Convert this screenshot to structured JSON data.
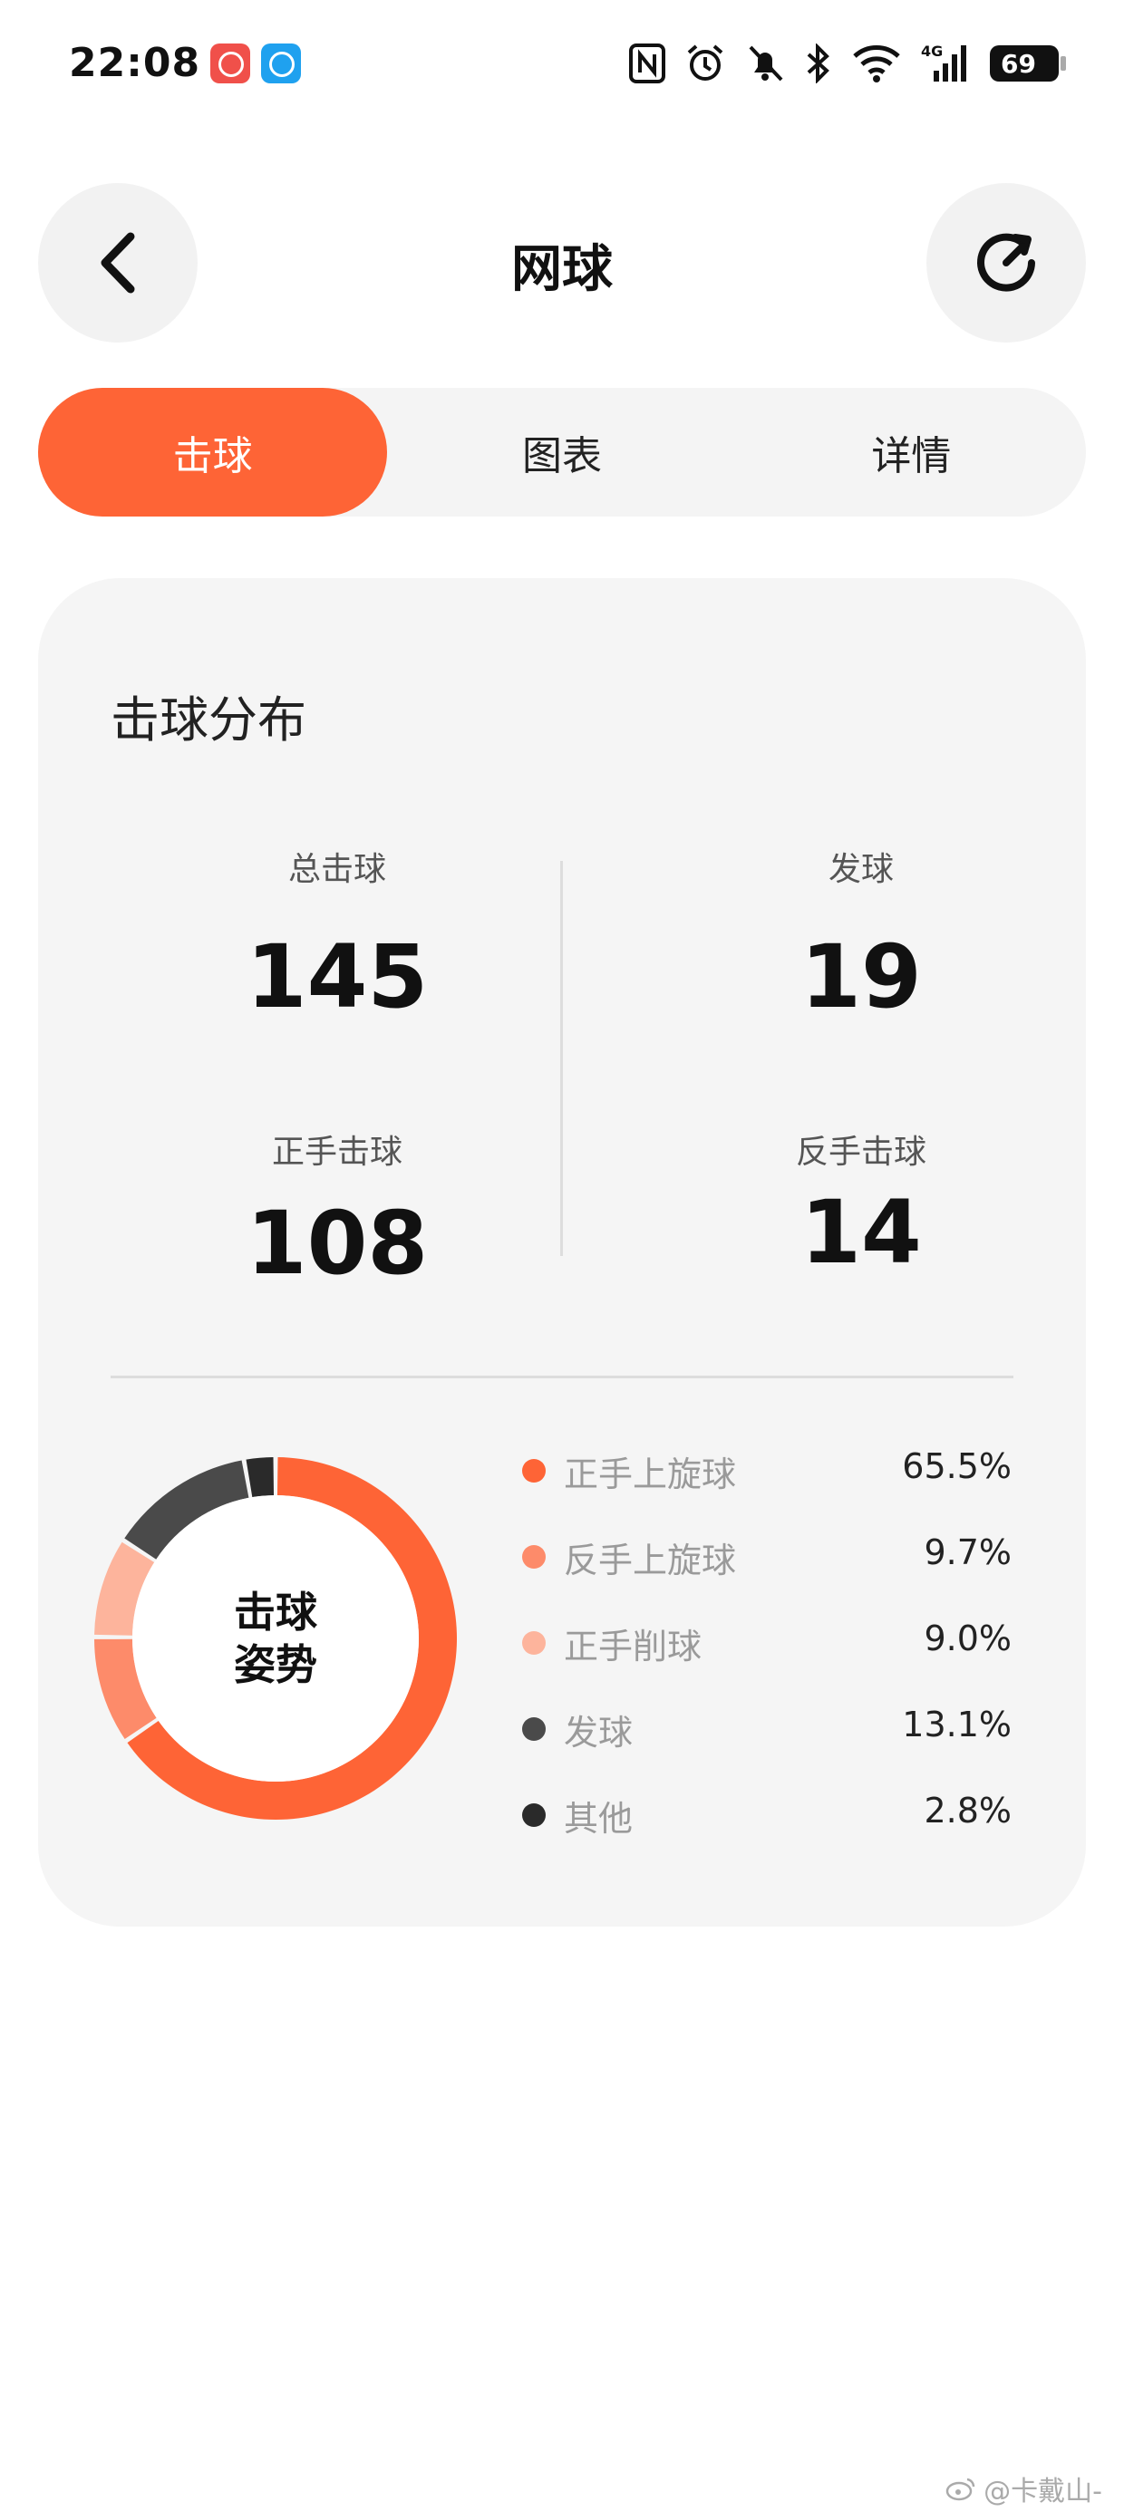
{
  "status_bar": {
    "time": "22:08",
    "battery": "69",
    "icons": [
      "nfc-icon",
      "alarm-icon",
      "mute-icon",
      "bluetooth-icon",
      "wifi-icon",
      "signal-4g-icon",
      "battery-icon"
    ]
  },
  "header": {
    "title": "网球",
    "back_icon": "back-chevron-icon",
    "refresh_icon": "refresh-icon"
  },
  "tabs": [
    {
      "label": "击球",
      "active": true
    },
    {
      "label": "图表",
      "active": false
    },
    {
      "label": "详情",
      "active": false
    }
  ],
  "card": {
    "title": "击球分布",
    "stats": {
      "total": {
        "label": "总击球",
        "value": "145"
      },
      "serve": {
        "label": "发球",
        "value": "19"
      },
      "forehand": {
        "label": "正手击球",
        "value": "108"
      },
      "backhand": {
        "label": "反手击球",
        "value": "14"
      }
    },
    "donut_center": [
      "击球",
      "姿势"
    ],
    "legend": [
      {
        "name": "正手上旋球",
        "pct": "65.5%",
        "value": 65.5,
        "color": "#fe6436"
      },
      {
        "name": "反手上旋球",
        "pct": "9.7%",
        "value": 9.7,
        "color": "#fd8b6a"
      },
      {
        "name": "正手削球",
        "pct": "9.0%",
        "value": 9.0,
        "color": "#fdb49c"
      },
      {
        "name": "发球",
        "pct": "13.1%",
        "value": 13.1,
        "color": "#4a4a4a"
      },
      {
        "name": "其他",
        "pct": "2.8%",
        "value": 2.8,
        "color": "#2a2a2a"
      }
    ]
  },
  "watermark": "@卡戴山-"
}
